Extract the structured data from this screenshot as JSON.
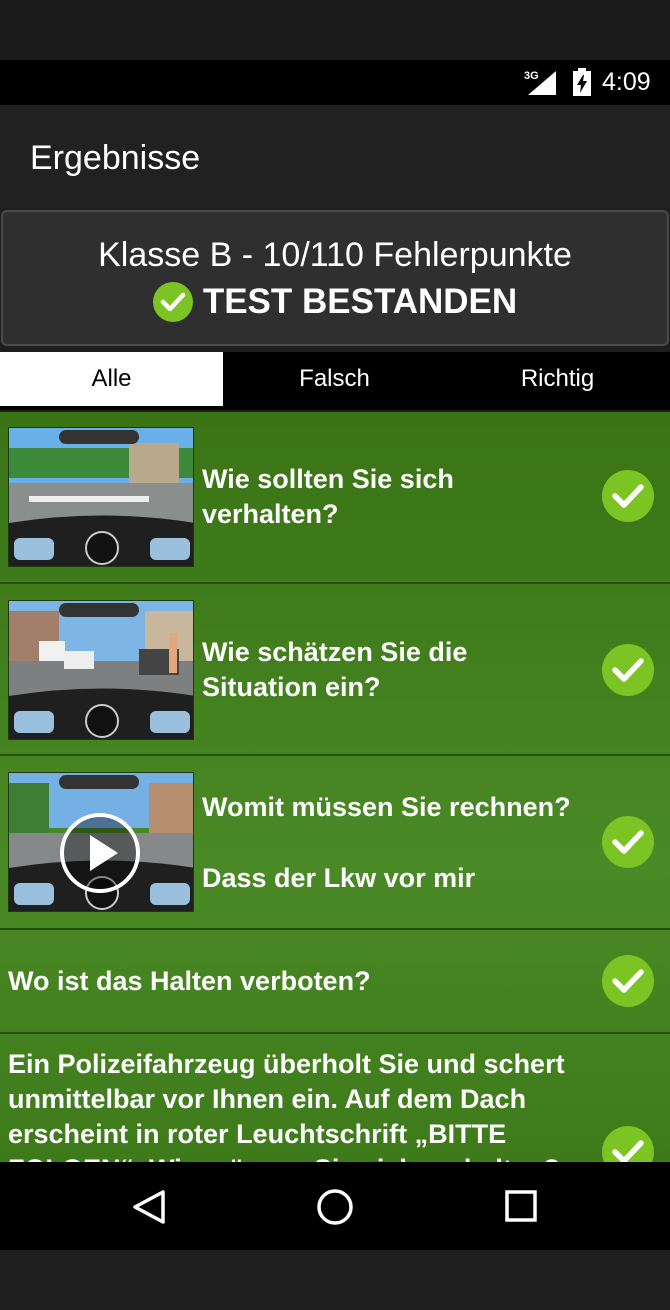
{
  "status_bar": {
    "network": "3G",
    "time": "4:09"
  },
  "app_bar": {
    "title": "Ergebnisse"
  },
  "result": {
    "summary": "Klasse B - 10/110 Fehlerpunkte",
    "status": "TEST BESTANDEN"
  },
  "tabs": [
    {
      "label": "Alle",
      "active": true
    },
    {
      "label": "Falsch",
      "active": false
    },
    {
      "label": "Richtig",
      "active": false
    }
  ],
  "questions": [
    {
      "text": "Wie sollten Sie sich verhalten?",
      "has_image": true,
      "has_video": false,
      "correct": true
    },
    {
      "text": "Wie schätzen Sie die Situation ein?",
      "has_image": true,
      "has_video": false,
      "correct": true
    },
    {
      "text": "Womit müssen Sie rechnen?",
      "answer": "Dass der Lkw vor mir",
      "has_image": true,
      "has_video": true,
      "correct": true
    },
    {
      "text": "Wo ist das Halten verboten?",
      "has_image": false,
      "has_video": false,
      "correct": true
    },
    {
      "text": "Ein Polizeifahrzeug überholt Sie und schert unmittelbar vor Ihnen ein. Auf dem Dach erscheint in roter Leuchtschrift „BITTE FOLGEN“. Wie müssen Sie sich verhalten?",
      "has_image": false,
      "has_video": false,
      "correct": true
    }
  ],
  "nav": {
    "back_icon": "back-triangle-icon",
    "home_icon": "home-circle-icon",
    "recents_icon": "recents-square-icon"
  },
  "colors": {
    "correct_accent": "#7cc324",
    "list_background": "#3f7b1b"
  }
}
